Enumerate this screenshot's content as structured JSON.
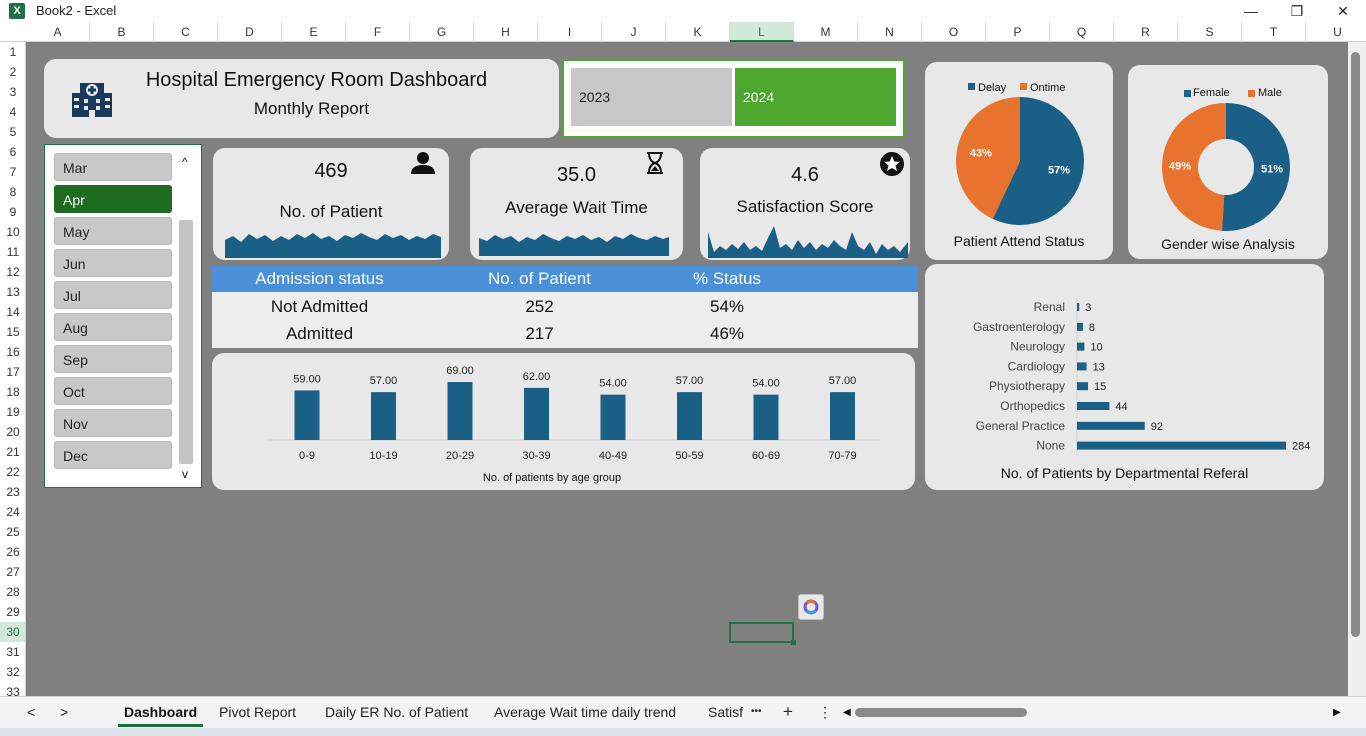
{
  "window": {
    "title": "Book2 - Excel",
    "app_icon": "X",
    "minimize": "—",
    "restore": "❐",
    "close": "✕"
  },
  "columns": [
    "A",
    "B",
    "C",
    "D",
    "E",
    "F",
    "G",
    "H",
    "I",
    "J",
    "K",
    "L",
    "M",
    "N",
    "O",
    "P",
    "Q",
    "R",
    "S",
    "T",
    "U"
  ],
  "selected_column": "L",
  "rows": [
    "1",
    "2",
    "3",
    "4",
    "5",
    "6",
    "7",
    "8",
    "9",
    "10",
    "11",
    "12",
    "13",
    "14",
    "15",
    "16",
    "17",
    "18",
    "19",
    "20",
    "21",
    "22",
    "23",
    "24",
    "25",
    "26",
    "27",
    "28",
    "29",
    "30",
    "31",
    "32",
    "33"
  ],
  "selected_row": "30",
  "header": {
    "title": "Hospital Emergency Room Dashboard",
    "subtitle": "Monthly Report",
    "icon": "hospital-icon"
  },
  "years": [
    {
      "label": "2023",
      "selected": false
    },
    {
      "label": "2024",
      "selected": true
    }
  ],
  "months": [
    {
      "label": "Mar",
      "selected": false
    },
    {
      "label": "Apr",
      "selected": true
    },
    {
      "label": "May",
      "selected": false
    },
    {
      "label": "Jun",
      "selected": false
    },
    {
      "label": "Jul",
      "selected": false
    },
    {
      "label": "Aug",
      "selected": false
    },
    {
      "label": "Sep",
      "selected": false
    },
    {
      "label": "Oct",
      "selected": false
    },
    {
      "label": "Nov",
      "selected": false
    },
    {
      "label": "Dec",
      "selected": false
    }
  ],
  "slicer_arrows": {
    "up": "^",
    "down": "v"
  },
  "kpis": [
    {
      "value": "469",
      "label": "No. of Patient",
      "icon": "person-icon"
    },
    {
      "value": "35.0",
      "label": "Average Wait Time",
      "icon": "hourglass-icon"
    },
    {
      "value": "4.6",
      "label": "Satisfaction Score",
      "icon": "star-icon"
    }
  ],
  "admission_table": {
    "headers": [
      "Admission status",
      "No. of Patient",
      "% Status"
    ],
    "rows": [
      [
        "Not Admitted",
        "252",
        "54%"
      ],
      [
        "Admitted",
        "217",
        "46%"
      ]
    ]
  },
  "colors": {
    "navy": "#1a5f85",
    "orange": "#e8732e",
    "green": "#4ea72e",
    "dark_green": "#1e6b22",
    "blue_header": "#4a90d9"
  },
  "chart_data": [
    {
      "type": "pie",
      "title": "Patient Attend Status",
      "legend_position": "top",
      "series": [
        {
          "name": "Delay",
          "value": 57,
          "label": "57%",
          "color": "#1a5f85"
        },
        {
          "name": "Ontime",
          "value": 43,
          "label": "43%",
          "color": "#e8732e"
        }
      ]
    },
    {
      "type": "pie",
      "donut": true,
      "title": "Gender wise Analysis",
      "legend_position": "top",
      "series": [
        {
          "name": "Female",
          "value": 51,
          "label": "51%",
          "color": "#1a5f85"
        },
        {
          "name": "Male",
          "value": 49,
          "label": "49%",
          "color": "#e8732e"
        }
      ]
    },
    {
      "type": "bar",
      "title": "No. of patients by age group",
      "categories": [
        "0-9",
        "10-19",
        "20-29",
        "30-39",
        "40-49",
        "50-59",
        "60-69",
        "70-79"
      ],
      "values": [
        59,
        57,
        69,
        62,
        54,
        57,
        54,
        57
      ],
      "value_labels": [
        "59.00",
        "57.00",
        "69.00",
        "62.00",
        "54.00",
        "57.00",
        "54.00",
        "57.00"
      ],
      "ylim": [
        0,
        100
      ],
      "grid": false
    },
    {
      "type": "bar",
      "orientation": "horizontal",
      "title": "No. of Patients by Departmental Referal",
      "categories": [
        "Renal",
        "Gastroenterology",
        "Neurology",
        "Cardiology",
        "Physiotherapy",
        "Orthopedics",
        "General Practice",
        "None"
      ],
      "values": [
        3,
        8,
        10,
        13,
        15,
        44,
        92,
        284
      ],
      "xlim": [
        0,
        284
      ],
      "grid": false
    }
  ],
  "sheet_tabs": [
    {
      "label": "Dashboard",
      "active": true
    },
    {
      "label": "Pivot Report",
      "active": false
    },
    {
      "label": "Daily ER No. of Patient",
      "active": false
    },
    {
      "label": "Average Wait time daily trend",
      "active": false
    },
    {
      "label": "Satisf",
      "active": false
    }
  ],
  "tab_controls": {
    "prev": "<",
    "next": ">",
    "more": "•••",
    "add": "+",
    "menu": "⋮"
  }
}
